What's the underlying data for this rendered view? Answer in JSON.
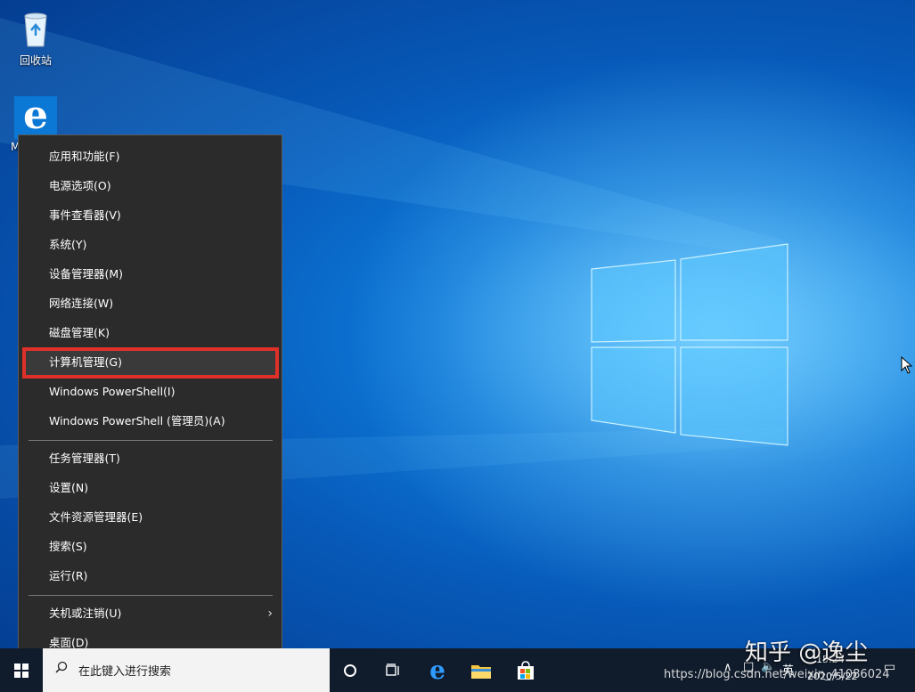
{
  "desktop": {
    "recycle_bin_label": "回收站",
    "edge_label": "Mi"
  },
  "context_menu": {
    "items": [
      {
        "label": "应用和功能(F)"
      },
      {
        "label": "电源选项(O)"
      },
      {
        "label": "事件查看器(V)"
      },
      {
        "label": "系统(Y)"
      },
      {
        "label": "设备管理器(M)"
      },
      {
        "label": "网络连接(W)"
      },
      {
        "label": "磁盘管理(K)"
      },
      {
        "label": "计算机管理(G)"
      },
      {
        "label": "Windows PowerShell(I)"
      },
      {
        "label": "Windows PowerShell (管理员)(A)"
      },
      {
        "label": "任务管理器(T)"
      },
      {
        "label": "设置(N)"
      },
      {
        "label": "文件资源管理器(E)"
      },
      {
        "label": "搜索(S)"
      },
      {
        "label": "运行(R)"
      },
      {
        "label": "关机或注销(U)"
      },
      {
        "label": "桌面(D)"
      }
    ],
    "highlighted_item": "计算机管理(G)",
    "highlight_color": "#e0302a"
  },
  "taskbar": {
    "search_placeholder": "在此键入进行搜索",
    "tray_lang": "英",
    "date": "2020/5/22",
    "time": "15:24"
  },
  "watermark": {
    "text": "知乎 @逸尘",
    "url": "https://blog.csdn.net/weixin_41086024"
  },
  "colors": {
    "menu_bg": "#2b2b2b",
    "accent": "#0078d7"
  }
}
